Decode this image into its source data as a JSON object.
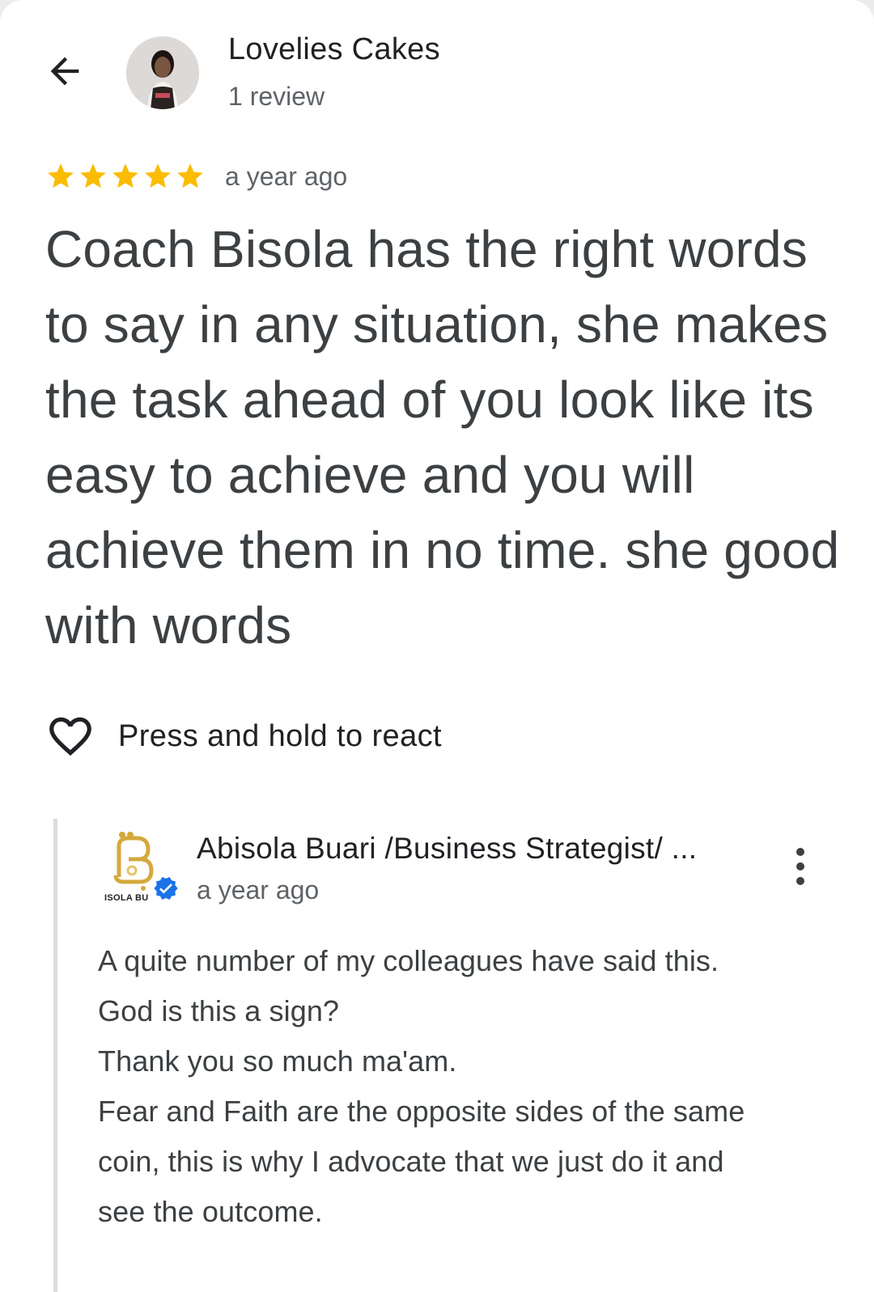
{
  "header": {
    "reviewer_name": "Lovelies Cakes",
    "review_count": "1 review",
    "back_icon": "arrow-back-icon"
  },
  "review": {
    "rating": 5,
    "max_rating": 5,
    "star_color": "#FBBC04",
    "date": "a year ago",
    "text": "Coach Bisola has the right words to say in any situation, she makes the task ahead of you look like its easy to achieve and you will achieve them in no time. she good with words"
  },
  "reaction": {
    "label": "Press and hold to react",
    "icon": "heart-outline-icon"
  },
  "owner_reply": {
    "name": "Abisola Buari /Business Strategist/ ...",
    "date": "a year ago",
    "logo_text": "ISOLA BU",
    "verified_color": "#1A73E8",
    "logo_color": "#D4A93C",
    "more_icon": "more-vert-icon",
    "lines": [
      "A quite number of my colleagues have said this.",
      "God is this a sign?",
      "Thank you so much ma'am.",
      "Fear and Faith are the opposite sides of the same",
      "coin, this is why I advocate that we just do it and",
      "see the outcome."
    ]
  }
}
